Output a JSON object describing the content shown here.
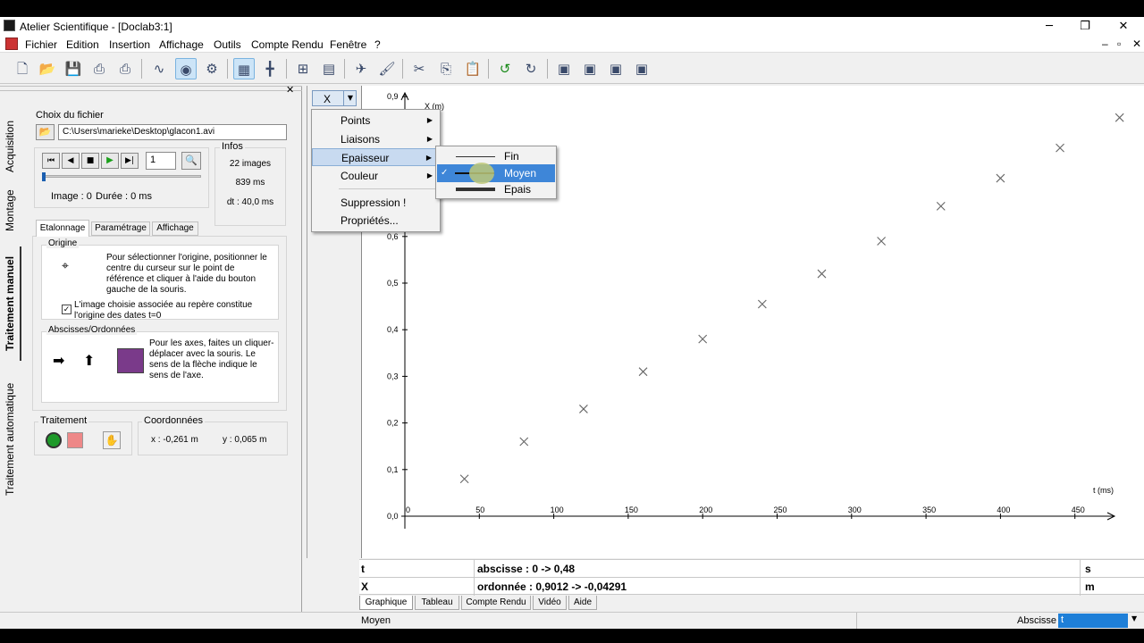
{
  "window": {
    "title": "Atelier Scientifique - [Doclab3:1]",
    "minimize": "─",
    "maximize": "❐",
    "close": "✕"
  },
  "menu": [
    "Fichier",
    "Edition",
    "Insertion",
    "Affichage",
    "Outils",
    "Compte Rendu",
    "Fenêtre",
    "?"
  ],
  "mdi": {
    "minimize": "–",
    "restore": "▫",
    "close": "✕"
  },
  "panel": {
    "close": "✕",
    "vtabs": [
      "Acquisition",
      "Montage",
      "Traitement manuel",
      "Traitement automatique"
    ],
    "file_label": "Choix du fichier",
    "file_path": "C:\\Users\\marieke\\Desktop\\glacon1.avi",
    "frame_value": "1",
    "image_label": "Image : 0",
    "duration_label": "Durée : 0 ms",
    "infos_title": "Infos",
    "infos_images": "22 images",
    "infos_ms": "839 ms",
    "infos_dt": "dt : 40,0 ms",
    "tabs": [
      "Etalonnage",
      "Paramétrage",
      "Affichage"
    ],
    "origin_title": "Origine",
    "origin_text": "Pour sélectionner l'origine, positionner le centre du curseur sur le point de référence et cliquer à l'aide du bouton gauche de la souris.",
    "origin_check": "L'image choisie associée au repère constitue l'origine des dates t=0",
    "axes_title": "Abscisses/Ordonnées",
    "axes_text": "Pour les axes, faites un cliquer-déplacer avec la souris. Le sens de la flèche indique le sens de l'axe.",
    "traitement_title": "Traitement",
    "coords_title": "Coordonnées",
    "coord_x": "x : -0,261 m",
    "coord_y": "y : 0,065 m"
  },
  "series_dropdown": "X",
  "context_menu": {
    "items": [
      "Points",
      "Liaisons",
      "Epaisseur",
      "Couleur",
      "Suppression !",
      "Propriétés..."
    ]
  },
  "submenu": {
    "items": [
      "Fin",
      "Moyen",
      "Epais"
    ],
    "checked": "Moyen"
  },
  "chart_data": {
    "type": "scatter",
    "ylabel": "X (m)",
    "xlabel": "t (ms)",
    "xlim": [
      0,
      480
    ],
    "ylim": [
      0,
      0.9
    ],
    "x_ticks": [
      "0",
      "50",
      "100",
      "150",
      "200",
      "250",
      "300",
      "350",
      "400",
      "450"
    ],
    "y_ticks": [
      "0,0",
      "0,1",
      "0,2",
      "0,3",
      "0,4",
      "0,5",
      "0,6",
      "0,9"
    ],
    "series": [
      {
        "x": [
          40,
          80,
          120,
          160,
          200,
          240,
          280,
          320,
          360,
          400,
          440,
          480
        ],
        "y": [
          0.08,
          0.16,
          0.23,
          0.31,
          0.38,
          0.455,
          0.52,
          0.59,
          0.665,
          0.725,
          0.79,
          0.855
        ]
      }
    ],
    "marker": "x"
  },
  "table": [
    {
      "name": "t",
      "desc": "abscisse : 0 -> 0,48",
      "unit": "s"
    },
    {
      "name": "X",
      "desc": "ordonnée : 0,9012 -> -0,04291",
      "unit": "m"
    }
  ],
  "bottom_tabs": [
    "Graphique",
    "Tableau",
    "Compte Rendu",
    "Vidéo",
    "Aide"
  ],
  "status": {
    "text": "Moyen",
    "right_label": "Abscisse",
    "right_value": "t"
  }
}
